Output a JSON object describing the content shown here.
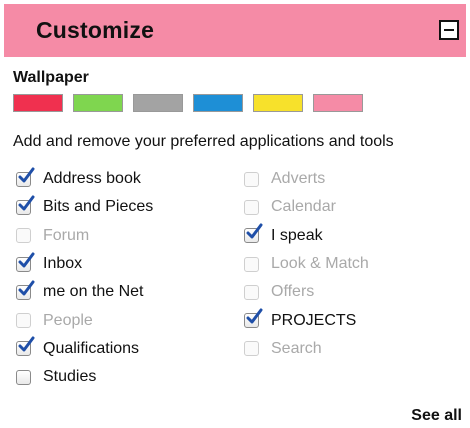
{
  "panel": {
    "title": "Customize",
    "collapse_icon": "minus-box-icon"
  },
  "wallpaper": {
    "label": "Wallpaper",
    "swatches": [
      {
        "name": "red",
        "color": "#f0304f"
      },
      {
        "name": "green",
        "color": "#7fd64f"
      },
      {
        "name": "gray",
        "color": "#a3a3a3"
      },
      {
        "name": "blue",
        "color": "#1e8fd6"
      },
      {
        "name": "yellow",
        "color": "#f7e12b"
      },
      {
        "name": "pink",
        "color": "#f58ba6"
      }
    ]
  },
  "applications": {
    "instructions": "Add and remove your preferred applications and tools",
    "items": [
      {
        "label": "Address book",
        "checked": true,
        "enabled": true
      },
      {
        "label": "Adverts",
        "checked": false,
        "enabled": false
      },
      {
        "label": "Bits and Pieces",
        "checked": true,
        "enabled": true
      },
      {
        "label": "Calendar",
        "checked": false,
        "enabled": false
      },
      {
        "label": "Forum",
        "checked": false,
        "enabled": false
      },
      {
        "label": "I speak",
        "checked": true,
        "enabled": true
      },
      {
        "label": "Inbox",
        "checked": true,
        "enabled": true
      },
      {
        "label": "Look & Match",
        "checked": false,
        "enabled": false
      },
      {
        "label": "me on the Net",
        "checked": true,
        "enabled": true
      },
      {
        "label": "Offers",
        "checked": false,
        "enabled": false
      },
      {
        "label": "People",
        "checked": false,
        "enabled": false
      },
      {
        "label": "PROJECTS",
        "checked": true,
        "enabled": true
      },
      {
        "label": "Qualifications",
        "checked": true,
        "enabled": true
      },
      {
        "label": "Search",
        "checked": false,
        "enabled": false
      },
      {
        "label": "Studies",
        "checked": false,
        "enabled": true
      }
    ]
  },
  "footer": {
    "see_all": "See all"
  },
  "colors": {
    "header_bg": "#f58ba6",
    "check_blue": "#1f4fa8"
  }
}
